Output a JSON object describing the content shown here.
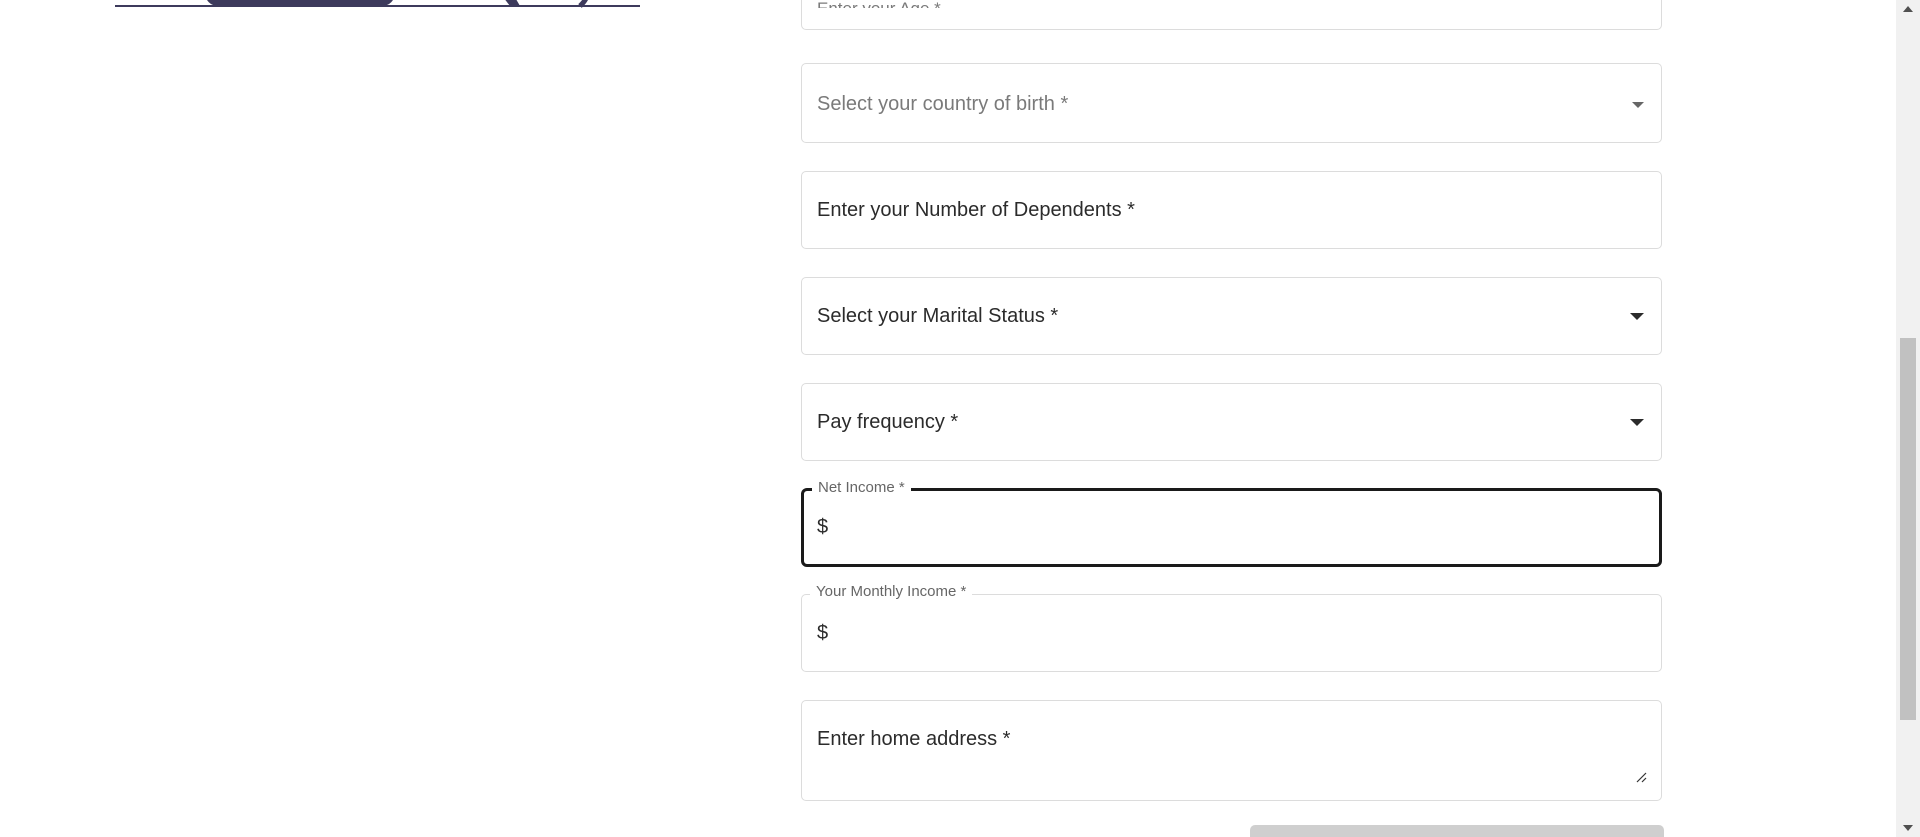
{
  "form": {
    "partial_top_field": {
      "text": "Enter your Age *"
    },
    "country_of_birth": {
      "placeholder": "Select your country of birth *",
      "icon": "chevron-down-icon"
    },
    "dependents": {
      "placeholder": "Enter your Number of Dependents *"
    },
    "marital_status": {
      "placeholder": "Select your Marital Status *",
      "icon": "chevron-down-icon"
    },
    "pay_frequency": {
      "placeholder": "Pay frequency *",
      "icon": "chevron-down-icon"
    },
    "net_income": {
      "label": "Net Income *",
      "prefix": "$",
      "value": ""
    },
    "monthly_income": {
      "label": "Your Monthly Income *",
      "prefix": "$",
      "value": ""
    },
    "home_address": {
      "placeholder": "Enter home address *",
      "icon": "resize-handle-icon"
    }
  },
  "colors": {
    "focus_border": "#1a1a1a",
    "field_border": "#dcdcdc",
    "illustration": "#3d3a5c",
    "button_disabled": "#cfcfcf"
  }
}
